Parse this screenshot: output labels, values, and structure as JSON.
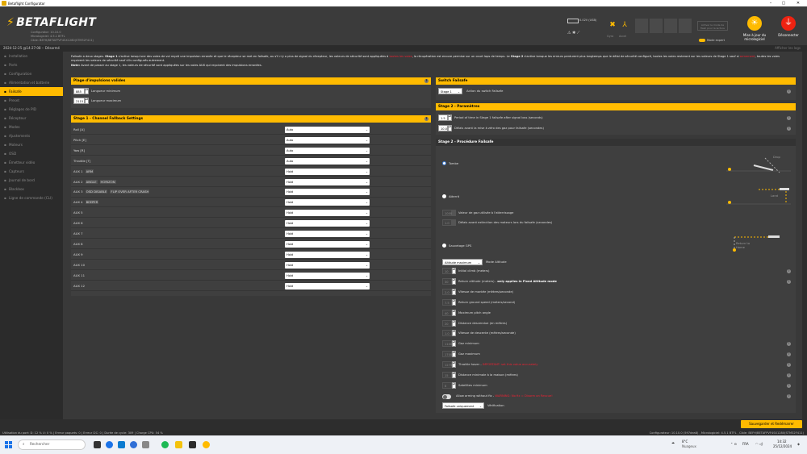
{
  "window": {
    "title": "Betaflight Configurator"
  },
  "header": {
    "logo": "BETAFLIGHT",
    "subinfo": [
      "Configurator: 10.10.0",
      "Micrologiciel: 4.5.1 BTFL",
      "Cible: BEFH/BETAFPVF4SX1280(STM32F411)"
    ],
    "voltage": "0.02V (USB)",
    "sensors": [
      "Gyro",
      "Accel",
      "Mag",
      "Baro",
      "GPS",
      "Sonar"
    ],
    "expert_button": "Activer le mode de flash pour la lecture",
    "expert_label": "Mode expert",
    "update_label": "Mise à jour du micrologiciel",
    "disconnect_label": "Déconnecter",
    "accent": "#ffbb00"
  },
  "status_line": {
    "text": "2024-12-25 @14:27:08 -- Désarmé",
    "show_log": "Afficher les logs"
  },
  "sidebar": {
    "items": [
      {
        "icon": "wrench-icon",
        "label": "Installation"
      },
      {
        "icon": "plug-icon",
        "label": "Ports"
      },
      {
        "icon": "gear-icon",
        "label": "Configuration"
      },
      {
        "icon": "battery-icon",
        "label": "Alimentation et batterie"
      },
      {
        "icon": "umbrella-icon",
        "label": "Failsafe",
        "active": true
      },
      {
        "icon": "wand-icon",
        "label": "Preset"
      },
      {
        "icon": "sliders-icon",
        "label": "Réglages de PID"
      },
      {
        "icon": "receiver-icon",
        "label": "Récepteur"
      },
      {
        "icon": "modes-icon",
        "label": "Modes"
      },
      {
        "icon": "adjust-icon",
        "label": "Ajustements"
      },
      {
        "icon": "motor-icon",
        "label": "Moteurs"
      },
      {
        "icon": "osd-icon",
        "label": "OSD"
      },
      {
        "icon": "video-icon",
        "label": "Émetteur vidéo"
      },
      {
        "icon": "sensor-icon",
        "label": "Capteurs"
      },
      {
        "icon": "log-icon",
        "label": "Journal de bord"
      },
      {
        "icon": "blackbox-icon",
        "label": "Blackbox"
      },
      {
        "icon": "terminal-icon",
        "label": "Ligne de commande (CLI)"
      }
    ]
  },
  "notice": {
    "p1a": "Failsafe a deux stages. ",
    "p1b": "Stage 1",
    "p1c": " s'active lorsqu'une des voies de vol reçoit une impulsion erronée et que le récepteur se met en failsafe, ou s'il n'y a plus de signal du récepteur, les valeurs de sécurité sont appliquées à ",
    "p1red": "toutes les voies",
    "p1d": ", la récupération est encore permise sur un court laps de temps. Le ",
    "p1e": "Stage 2",
    "p1f": " s'active lorsque les erreurs perdurent plus longtemps que le délai de sécurité configuré, toutes les voies resteront sur les valeurs de Stage 1 sauf si ",
    "p1red2": "armement",
    "p1g": ", toutes les voies",
    "p1h": "reçoivent les valeurs de sécurité sauf s'ils configurés autrement.",
    "p2a": "Note:",
    "p2b": " Avant de passer au stage 1, les valeurs de sécurité sont appliquées sur les voies AUX qui reçoivent des impulsions erronées."
  },
  "pulse_panel": {
    "title": "Plage d'impulsions valides",
    "min_value": "885",
    "min_label": "Longueur minimum",
    "max_value": "2115",
    "max_label": "Longueur maximum"
  },
  "stage1_panel": {
    "title": "Stage 1 - Channel Fallback Settings",
    "channels": [
      {
        "name": "Roll [A]",
        "value": "Auto"
      },
      {
        "name": "Pitch [E]",
        "value": "Auto"
      },
      {
        "name": "Yaw [R]",
        "value": "Auto"
      },
      {
        "name": "Throttle [T]",
        "value": "Auto"
      },
      {
        "name": "AUX 1",
        "tags": [
          "ARM"
        ],
        "value": "Hold"
      },
      {
        "name": "AUX 2",
        "tags": [
          "ANGLE",
          "HORIZON"
        ],
        "value": "Hold"
      },
      {
        "name": "AUX 3",
        "tags": [
          "OSD DISABLE",
          "FLIP OVER AFTER CRASH"
        ],
        "value": "Hold"
      },
      {
        "name": "AUX 4",
        "tags": [
          "BEEPER"
        ],
        "value": "Hold"
      },
      {
        "name": "AUX 5",
        "value": "Hold"
      },
      {
        "name": "AUX 6",
        "value": "Hold"
      },
      {
        "name": "AUX 7",
        "value": "Hold"
      },
      {
        "name": "AUX 8",
        "value": "Hold"
      },
      {
        "name": "AUX 9",
        "value": "Hold"
      },
      {
        "name": "AUX 10",
        "value": "Hold"
      },
      {
        "name": "AUX 11",
        "value": "Hold"
      },
      {
        "name": "AUX 12",
        "value": "Hold"
      }
    ]
  },
  "switch_panel": {
    "title": "Switch Failsafe",
    "select": "Stage 1",
    "label": "Action du switch Failsafe"
  },
  "stage2_params": {
    "title": "Stage 2 - Paramètres",
    "guard_value": "1.5",
    "guard_label": "Period of time in Stage 1 failsafe after signal loss (seconds)",
    "delay_value": "10.0",
    "delay_label": "Délais avant la mise à zéro des gaz pour failsafe (secondes)"
  },
  "stage2_proc": {
    "title": "Stage 2 - Procédure Failsafe",
    "drop_label": "Tombe",
    "drop_img": "Drop",
    "land_label": "Atterrit",
    "land_img": "Land",
    "land_throttle_value": "1000",
    "land_throttle_label": "Valeur de gaz utilisée à l'atterrissage",
    "land_delay_value": "1.0",
    "land_delay_label": "Délais avant extinction des moteurs lors du failsafe (secondes)",
    "gps_label": "Sauvetage GPS",
    "gps_img": "Return to Home",
    "alt_mode_select": "Altitude maximum",
    "alt_mode_label": "Mode Altitude",
    "fields": [
      {
        "value": "10",
        "label": "Initial climb (meters)"
      },
      {
        "value": "30",
        "label": "Return altitude (meters) - ",
        "bold": "only applies in Fixed Altitude mode"
      },
      {
        "value": "2.0",
        "label": "Vitesse de montée (mètres/seconde)"
      },
      {
        "value": "7.5",
        "label": "Return ground speed (meters/second)"
      },
      {
        "value": "40",
        "label": "Maximum pitch angle"
      },
      {
        "value": "20",
        "label": "Distance descendue (en mètres)"
      },
      {
        "value": "1.0",
        "label": "Vitesse de descente (mètres/seconde)"
      },
      {
        "value": "1100",
        "label": "Gaz minimum"
      },
      {
        "value": "1700",
        "label": "Gaz maximum"
      },
      {
        "value": "1275",
        "label": "Throttle hover - ",
        "red": "IMPORTANT: set this value accurately"
      },
      {
        "value": "15",
        "label": "Distance minimale à la maison (mètres)"
      },
      {
        "value": "8",
        "label": "Satellites minimum"
      }
    ],
    "arming_label": "Allow arming without fix - ",
    "arming_red": "WARNING: No fix = Disarm on Rescue!",
    "sanity_select": "Failsafe uniquement",
    "sanity_label": "Vérification"
  },
  "save_button": "Sauvegarder et Redémarrer",
  "footer": {
    "left": "Utilisation du port: D: 12 % U: 0 %  |  Erreur paquets: 0  |  Erreur I2C: 0  |  Durée de cycle: 309  |  Charge CPU: 54 %",
    "right": "Configurateur: 10.10.0 (597dea8) , Micrologiciel: 4.5.1 BTFL , Cible: BEFH/BETAFPVF4SX1280(STM32F411)"
  },
  "taskbar": {
    "search": "Rechercher",
    "weather_temp": "8°C",
    "weather_desc": "Nuageux",
    "lang": "FRA",
    "time": "14:32",
    "date": "25/12/2024"
  }
}
